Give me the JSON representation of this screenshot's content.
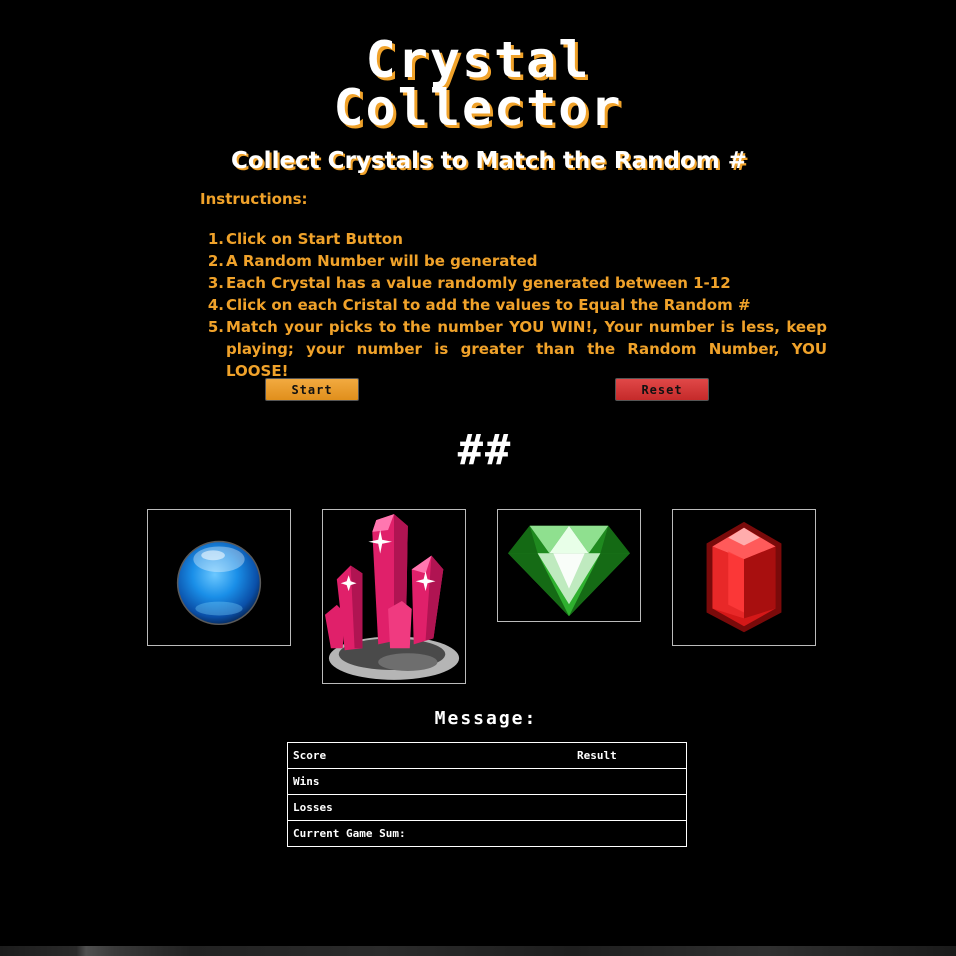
{
  "header": {
    "title_line1": "Crystal",
    "title_line2": "Collector",
    "subtitle": "Collect Crystals to Match the Random #"
  },
  "instructions": {
    "heading": "Instructions:",
    "steps": [
      {
        "num": "1.",
        "text": "Click on Start Button"
      },
      {
        "num": "2.",
        "text": "A Random Number will be generated"
      },
      {
        "num": "3.",
        "text": "Each Crystal has a value randomly generated between 1-12"
      },
      {
        "num": "4.",
        "text": "Click on each Cristal to add the values to Equal the Random #"
      },
      {
        "num": "5.",
        "text": "Match your picks to the number YOU WIN!, Your number is less, keep playing; your number is greater than the Random Number, YOU LOOSE!"
      }
    ]
  },
  "controls": {
    "start_label": "Start",
    "reset_label": "Reset"
  },
  "game": {
    "random_number": "##",
    "message_label": "Message:"
  },
  "crystals": [
    {
      "icon": "blue-orb-icon"
    },
    {
      "icon": "pink-crystal-cluster-icon"
    },
    {
      "icon": "green-diamond-icon"
    },
    {
      "icon": "red-gem-icon"
    }
  ],
  "scoreboard": {
    "score_label": "Score",
    "result_label": "Result",
    "wins_label": "Wins",
    "losses_label": "Losses",
    "sum_label": "Current Game Sum:"
  },
  "colors": {
    "accent": "#f0a22a",
    "reset": "#d03838",
    "background": "#000000"
  }
}
